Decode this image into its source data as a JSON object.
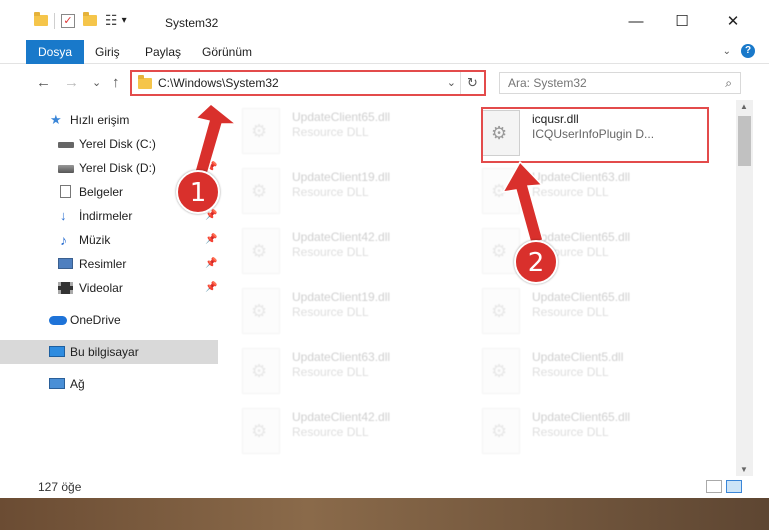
{
  "window": {
    "title": "System32",
    "minimize": "—",
    "maximize": "☐",
    "close": "✕"
  },
  "ribbon": {
    "tabs": [
      "Dosya",
      "Giriş",
      "Paylaş",
      "Görünüm"
    ],
    "help": "?"
  },
  "nav": {
    "back": "←",
    "forward": "→",
    "recent": "⌄",
    "up": "↑",
    "address": "C:\\Windows\\System32",
    "refresh": "↻",
    "search_placeholder": "Ara: System32"
  },
  "sidebar": {
    "items": [
      {
        "label": "Hızlı erişim"
      },
      {
        "label": "Yerel Disk (C:)"
      },
      {
        "label": "Yerel Disk (D:)"
      },
      {
        "label": "Belgeler"
      },
      {
        "label": "İndirmeler"
      },
      {
        "label": "Müzik"
      },
      {
        "label": "Resimler"
      },
      {
        "label": "Videolar"
      },
      {
        "label": "OneDrive"
      },
      {
        "label": "Bu bilgisayar"
      },
      {
        "label": "Ağ"
      }
    ]
  },
  "files": {
    "target": {
      "name": "icqusr.dll",
      "desc": "ICQUserInfoPlugin D..."
    },
    "left_column": [
      {
        "name": "UpdateClient65.dll",
        "desc": "Resource DLL"
      },
      {
        "name": "UpdateClient19.dll",
        "desc": "Resource DLL"
      },
      {
        "name": "UpdateClient42.dll",
        "desc": "Resource DLL"
      },
      {
        "name": "UpdateClient19.dll",
        "desc": "Resource DLL"
      },
      {
        "name": "UpdateClient63.dll",
        "desc": "Resource DLL"
      },
      {
        "name": "UpdateClient42.dll",
        "desc": "Resource DLL"
      }
    ],
    "right_column": [
      {
        "name": "UpdateClient63.dll",
        "desc": "Resource DLL"
      },
      {
        "name": "UpdateClient65.dll",
        "desc": "Resource DLL"
      },
      {
        "name": "UpdateClient65.dll",
        "desc": "Resource DLL"
      },
      {
        "name": "UpdateClient5.dll",
        "desc": "Resource DLL"
      },
      {
        "name": "UpdateClient65.dll",
        "desc": "Resource DLL"
      }
    ]
  },
  "status": {
    "count": "127 öğe"
  },
  "annotations": {
    "badge1": "1",
    "badge2": "2",
    "color": "#d9302c"
  }
}
